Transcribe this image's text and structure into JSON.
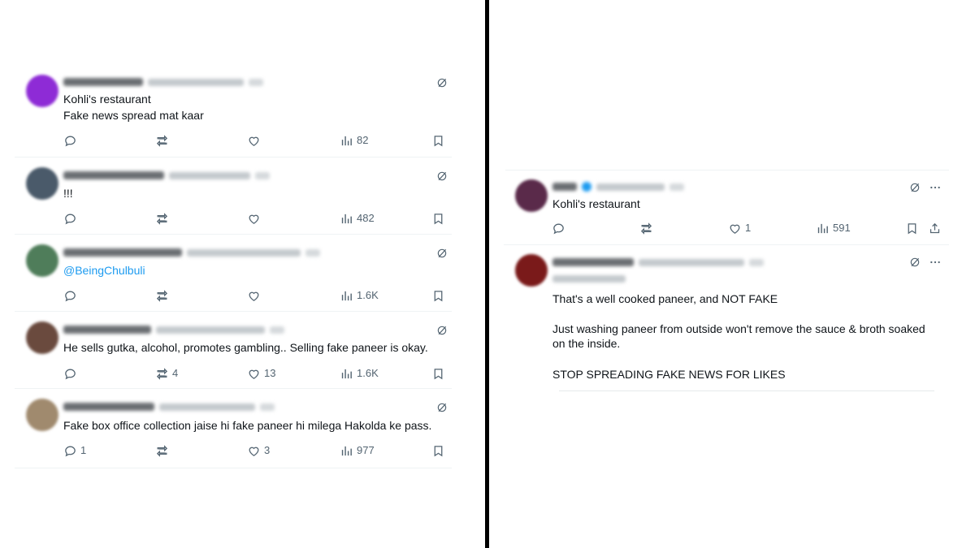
{
  "left_panel": {
    "tweets": [
      {
        "lines": [
          "Kohli's restaurant",
          "Fake news spread mat kaar"
        ],
        "replies": "",
        "retweets": "",
        "likes": "",
        "views": "82",
        "avatar_color": "#8e2bd6"
      },
      {
        "lines": [
          "!!!"
        ],
        "replies": "",
        "retweets": "",
        "likes": "",
        "views": "482",
        "avatar_color": "#4a5a6a"
      },
      {
        "lines": [
          "@BeingChulbuli"
        ],
        "replies": "",
        "retweets": "",
        "likes": "",
        "views": "1.6K",
        "avatar_color": "#4f7d5a"
      },
      {
        "lines": [
          "He sells gutka, alcohol, promotes gambling.. Selling fake paneer is okay."
        ],
        "replies": "",
        "retweets": "4",
        "likes": "13",
        "views": "1.6K",
        "avatar_color": "#6a4a3e"
      },
      {
        "lines": [
          "Fake box office collection jaise hi fake paneer hi milega Hakolda ke pass."
        ],
        "replies": "1",
        "retweets": "",
        "likes": "3",
        "views": "977",
        "avatar_color": "#a08a6e"
      }
    ]
  },
  "right_panel": {
    "tweets": [
      {
        "lines": [
          "Kohli's restaurant"
        ],
        "replies": "",
        "retweets": "",
        "likes": "1",
        "views": "591",
        "avatar_color": "#5a2a4a"
      },
      {
        "lines": [
          "That's a well cooked paneer, and NOT FAKE",
          "",
          "Just washing paneer from outside won't remove the sauce & broth soaked",
          "on the inside.",
          "",
          "STOP SPREADING FAKE NEWS FOR LIKES"
        ],
        "avatar_color": "#7a1a1a"
      }
    ]
  },
  "icons": {
    "reply": "reply-icon",
    "retweet": "retweet-icon",
    "like": "heart-icon",
    "views": "views-icon",
    "bookmark": "bookmark-icon",
    "share": "share-icon",
    "grok": "grok-icon",
    "more": "more-icon"
  },
  "colors": {
    "link": "#1d9bf0",
    "muted": "#536471",
    "text": "#0f1419"
  }
}
